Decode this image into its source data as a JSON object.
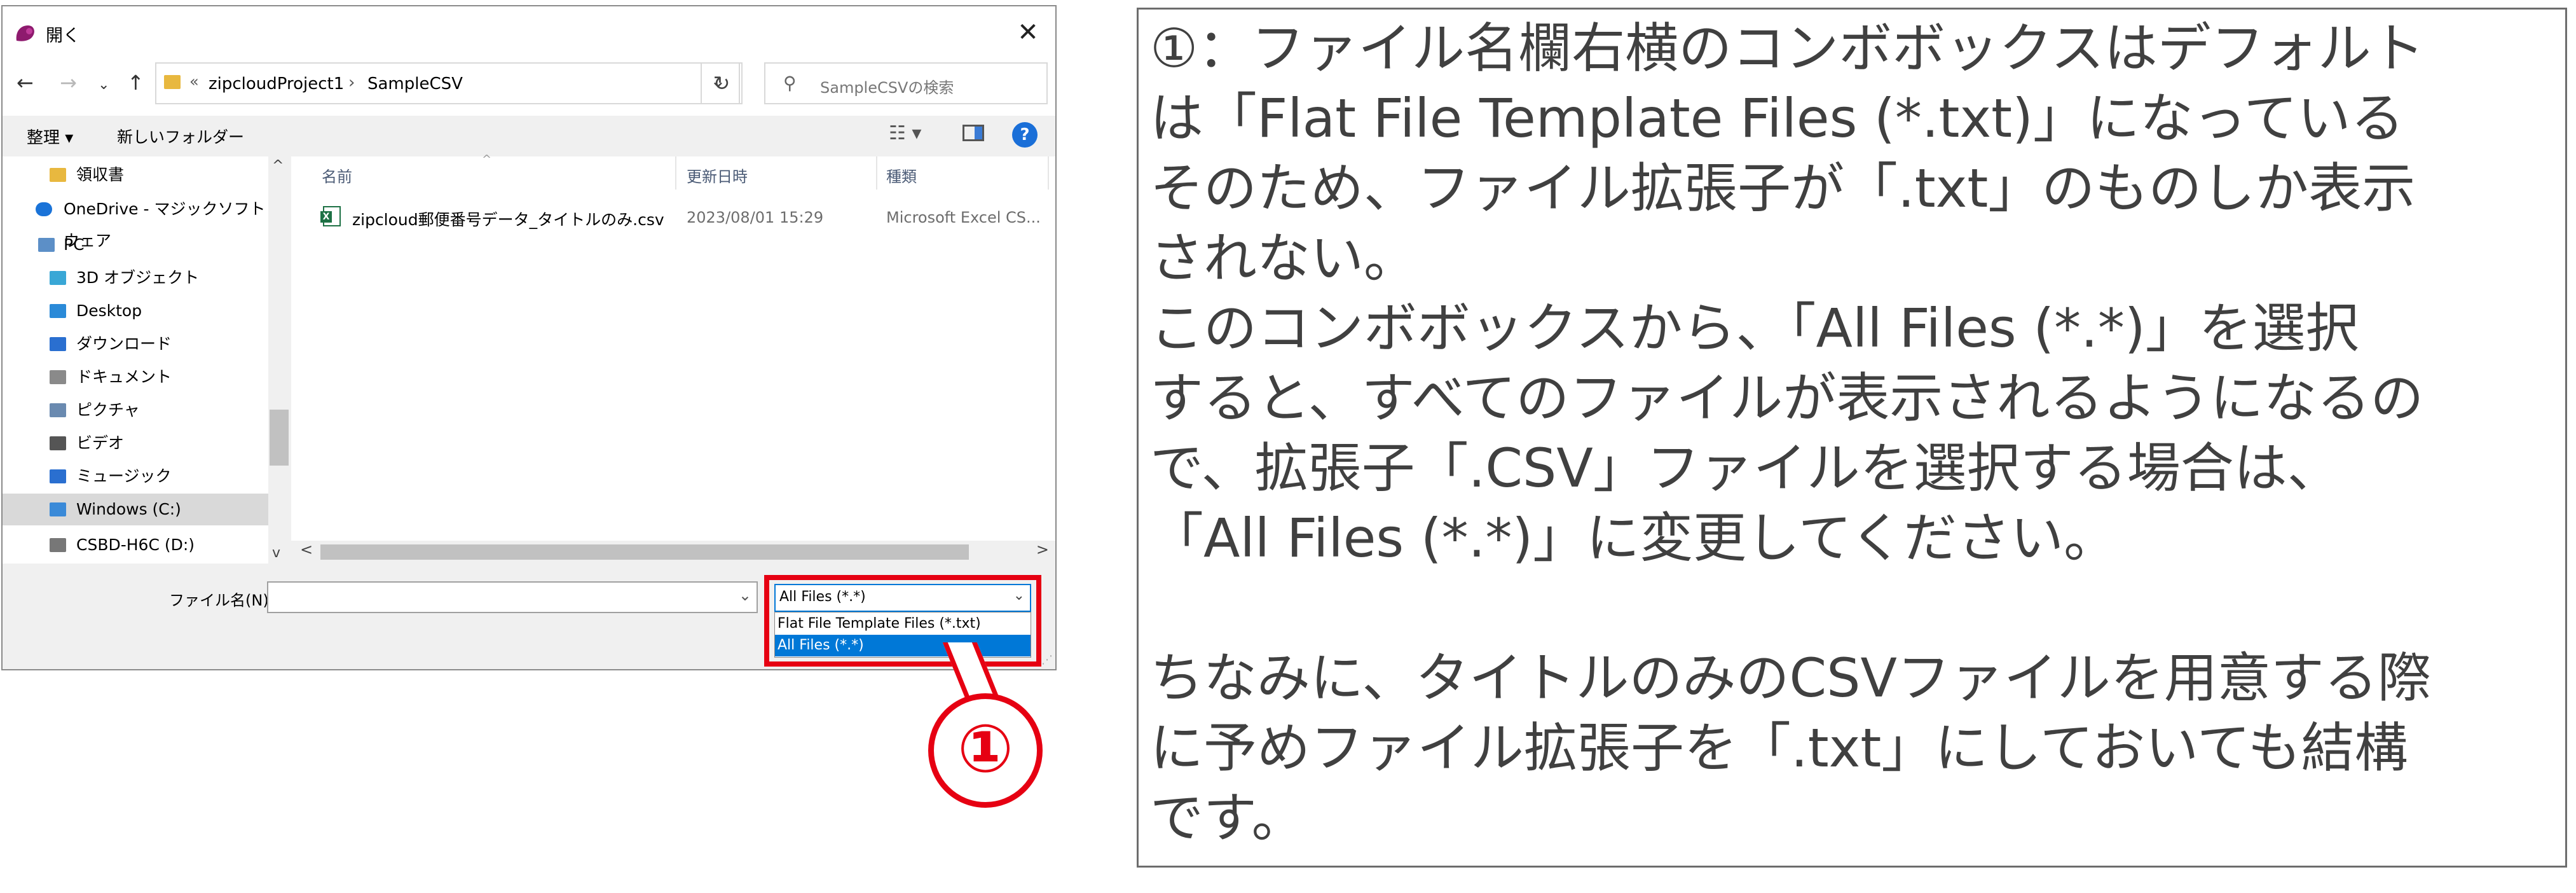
{
  "dialog": {
    "title": "開く",
    "close": "✕",
    "nav": {
      "back": "←",
      "forward": "→",
      "recent": "⌄",
      "up": "↑",
      "refresh": "↻"
    },
    "address": {
      "lead": "«",
      "segments": [
        "zipcloudProject1",
        "SampleCSV"
      ],
      "sep": "›",
      "dropdown": "⌄"
    },
    "search": {
      "icon": "⚲",
      "placeholder": "SampleCSVの検索"
    },
    "toolbar": {
      "organize": "整理 ▾",
      "new_folder": "新しいフォルダー",
      "view": "☷ ▾",
      "help": "?"
    },
    "nav_pane": {
      "items": [
        {
          "label": "領収書",
          "icon": "folder-icon",
          "color": "#e8b83f"
        },
        {
          "label": "OneDrive - マジックソフトウェア",
          "icon": "cloud-icon",
          "color": "#1a73d8"
        },
        {
          "label": "PC",
          "icon": "pc-icon",
          "color": "#5c8fc7"
        },
        {
          "label": "3D オブジェクト",
          "icon": "cube-icon",
          "color": "#39a7d6"
        },
        {
          "label": "Desktop",
          "icon": "desktop-icon",
          "color": "#2a8ad8"
        },
        {
          "label": "ダウンロード",
          "icon": "download-icon",
          "color": "#2a6fd0"
        },
        {
          "label": "ドキュメント",
          "icon": "document-icon",
          "color": "#8a8a8a"
        },
        {
          "label": "ピクチャ",
          "icon": "picture-icon",
          "color": "#6a8ab0"
        },
        {
          "label": "ビデオ",
          "icon": "video-icon",
          "color": "#555555"
        },
        {
          "label": "ミュージック",
          "icon": "music-icon",
          "color": "#2a6fd0"
        },
        {
          "label": "Windows (C:)",
          "icon": "drive-icon",
          "color": "#3a8ad8"
        },
        {
          "label": "CSBD-H6C (D:)",
          "icon": "drive-icon",
          "color": "#777777"
        }
      ],
      "scroll_up": "^",
      "scroll_down": "v"
    },
    "columns": {
      "name": "名前",
      "date": "更新日時",
      "type": "種類",
      "sort": "^"
    },
    "files": [
      {
        "name": "zipcloud郵便番号データ_タイトルのみ.csv",
        "date": "2023/08/01 15:29",
        "type": "Microsoft Excel CS..."
      }
    ],
    "hscroll": {
      "left": "<",
      "right": ">"
    },
    "bottom": {
      "filename_label": "ファイル名(N):",
      "filename_value": "",
      "filename_dd": "⌄",
      "filetype_selected": "All Files (*.*)",
      "filetype_dd": "⌄",
      "filetype_options": [
        "Flat File Template Files (*.txt)",
        "All Files (*.*)"
      ],
      "grip": "⋰"
    }
  },
  "callout": {
    "label": "①",
    "color": "#e60012"
  },
  "note": {
    "lines": [
      "①：ファイル名欄右横のコンボボックスはデフォルト",
      "は「Flat File Template Files (*.txt)」になっている",
      "そのため、ファイル拡張子が「.txt」のものしか表示",
      "されない。",
      "このコンボボックスから、「All Files (*.*)」を選択",
      "すると、すべてのファイルが表示されるようになるの",
      "で、拡張子「.CSV」ファイルを選択する場合は、",
      "「All Files (*.*)」に変更してください。",
      "",
      "ちなみに、タイトルのみのCSVファイルを用意する際",
      "に予めファイル拡張子を「.txt」にしておいても結構",
      "です。"
    ]
  }
}
